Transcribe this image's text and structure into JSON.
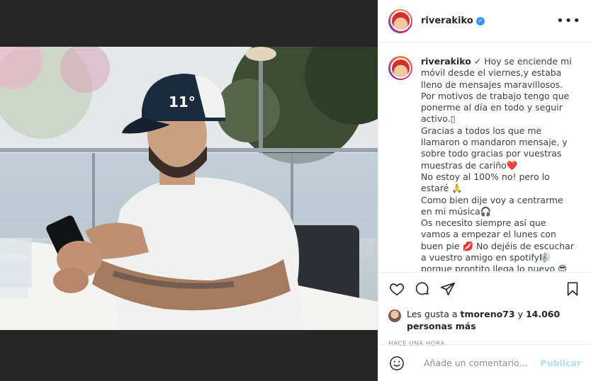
{
  "post": {
    "username": "riverakiko",
    "verified_icon": "verified-badge-icon",
    "more_icon": "more-options-icon"
  },
  "caption": {
    "username": "riverakiko",
    "text": " ✓ Hoy se enciende mi móvil desde el viernes,y estaba lleno de mensajes maravillosos.\nPor motivos de trabajo tengo que ponerme al día en todo y seguir activo.▯\nGracias a todos los que me llamaron o mandaron mensaje, y sobre todo gracias por vuestras muestras de cariño❤️\nNo estoy al 100% no! pero lo estaré 🙏\nComo bien dije voy a centrarme en mi música🎧\nOs necesito siempre así que vamos a empezar el lunes con buen pie 💋 No dejéis de escuchar a vuestro amigo en spotify🎼 porque prontito llega lo nuevo 😎"
  },
  "actions": {
    "like_icon": "heart-icon",
    "comment_icon": "comment-icon",
    "share_icon": "share-icon",
    "save_icon": "bookmark-icon"
  },
  "likes": {
    "prefix": "Les gusta a ",
    "user": "tmoreno73",
    "mid": " y ",
    "count": "14.060 personas más"
  },
  "timestamp": "HACE UNA HORA",
  "comment": {
    "placeholder": "Añade un comentario...",
    "publish_label": "Publicar",
    "emoji_icon": "emoji-icon"
  },
  "colors": {
    "accent": "#3897f0",
    "publish_disabled": "#b2dffc",
    "muted": "#8e8e8e"
  }
}
